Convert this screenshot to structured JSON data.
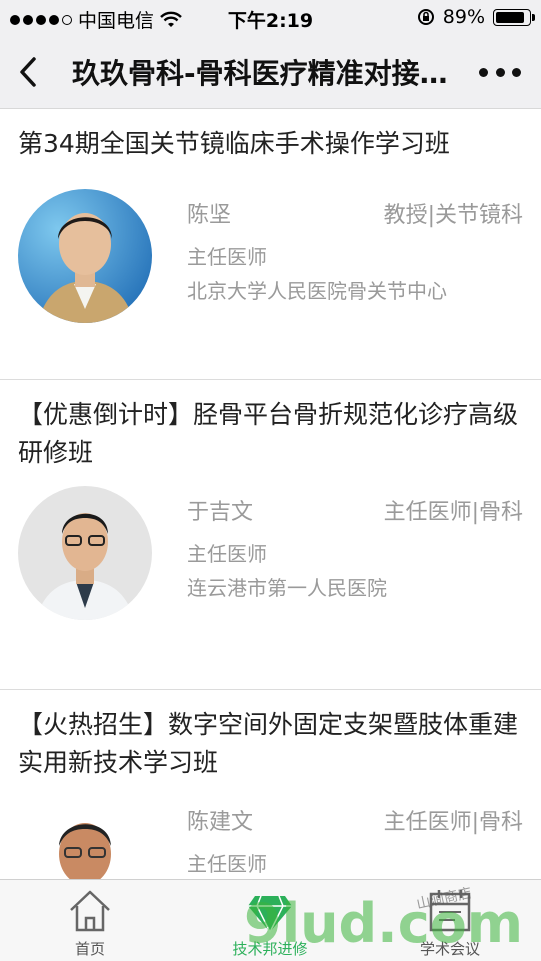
{
  "status": {
    "carrier": "中国电信",
    "time": "下午2:19",
    "battery": "89%",
    "battery_level": 0.89
  },
  "nav": {
    "title": "玖玖骨科-骨科医疗精准对接平台"
  },
  "courses": [
    {
      "title": "第34期全国关节镜临床手术操作学习班",
      "name": "陈坚",
      "dept": "教授|关节镜科",
      "rank": "主任医师",
      "hospital": "北京大学人民医院骨关节中心"
    },
    {
      "title": "【优惠倒计时】胫骨平台骨折规范化诊疗高级研修班",
      "name": "于吉文",
      "dept": "主任医师|骨科",
      "rank": "主任医师",
      "hospital": "连云港市第一人民医院"
    },
    {
      "title": "【火热招生】数字空间外固定支架暨肢体重建实用新技术学习班",
      "name": "陈建文",
      "dept": "主任医师|骨科",
      "rank": "主任医师",
      "hospital": ""
    }
  ],
  "tabs": [
    {
      "label": "首页",
      "icon": "home-icon"
    },
    {
      "label": "技术邦进修",
      "icon": "diamond-icon"
    },
    {
      "label": "学术会议",
      "icon": "calendar-icon"
    }
  ],
  "watermark": {
    "text": "9lud.com",
    "subtext": "山涧商店"
  },
  "colors": {
    "active_tab": "#2cb05a",
    "secondary_text": "#9a9a9a",
    "bar_bg": "#f0f0f2"
  }
}
